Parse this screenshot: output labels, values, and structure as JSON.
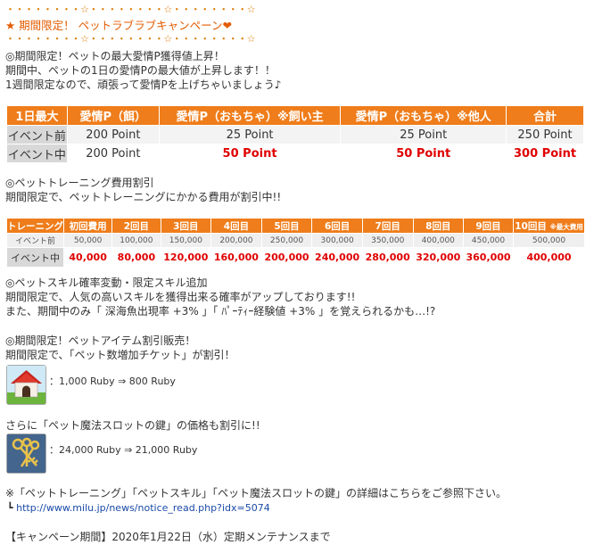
{
  "header": {
    "ornament": "・・・・・・・・☆・・・・・・・・☆・・・・・・・・☆",
    "title": "★ 期間限定！ ペットラブラブキャンペーン❤"
  },
  "section1": {
    "lines": [
      "◎期間限定！ペットの最大愛情P獲得値上昇！",
      "期間中、ペットの1日の愛情Pの最大値が上昇します！！",
      "1週間限定なので、頑張って愛情Pを上げちゃいましょう♪"
    ]
  },
  "table1": {
    "headers": [
      "1日最大",
      "愛情P（餌）",
      "愛情P（おもちゃ）※飼い主",
      "愛情P（おもちゃ）※他人",
      "合計"
    ],
    "rows": [
      {
        "label": "イベント前",
        "values": [
          "200 Point",
          "25 Point",
          "25 Point",
          "250 Point"
        ]
      },
      {
        "label": "イベント中",
        "values": [
          "200 Point",
          "50 Point",
          "50 Point",
          "300 Point"
        ]
      }
    ]
  },
  "section2": {
    "lines": [
      "◎ペットトレーニング費用割引",
      "期間限定で、ペットトレーニングにかかる費用が割引中!!"
    ]
  },
  "table2": {
    "headers": [
      "トレーニング",
      "初回費用",
      "2回目",
      "3回目",
      "4回目",
      "5回目",
      "6回目",
      "7回目",
      "8回目",
      "9回目",
      "10回目"
    ],
    "header_note": "※最大費用",
    "rows": [
      {
        "label": "イベント前",
        "values": [
          "50,000",
          "100,000",
          "150,000",
          "200,000",
          "250,000",
          "300,000",
          "350,000",
          "400,000",
          "450,000",
          "500,000"
        ]
      },
      {
        "label": "イベント中",
        "values": [
          "40,000",
          "80,000",
          "120,000",
          "160,000",
          "200,000",
          "240,000",
          "280,000",
          "320,000",
          "360,000",
          "400,000"
        ]
      }
    ]
  },
  "section3": {
    "lines": [
      "◎ペットスキル確率変動・限定スキル追加",
      "期間限定で、人気の高いスキルを獲得出来る確率がアップしております!!",
      "また、期間中のみ「 深海魚出現率 +3% 」「 ﾊﾟｰﾃｨｰ経験値 +3% 」を覚えられるかも…!?"
    ]
  },
  "section4": {
    "lines": [
      "◎期間限定！ペットアイテム割引販売！",
      "期間限定で、「ペット数増加チケット」が割引！"
    ],
    "item1_price": "：1,000 Ruby ⇒ 800 Ruby",
    "line3": "さらに「ペット魔法スロットの鍵」の価格も割引に!!",
    "item2_price": "：24,000 Ruby ⇒ 21,000 Ruby"
  },
  "footer": {
    "note": "※「ペットトレーニング」「ペットスキル」「ペット魔法スロットの鍵」の詳細はこちらをご参照下さい。",
    "arrow": "┗",
    "link": "http://www.milu.jp/news/notice_read.php?idx=5074",
    "period": "【キャンペーン期間】2020年1月22日（水）定期メンテナンスまで"
  },
  "colors": {
    "header_orange": "#ef7d1b",
    "accent_red": "#e00000",
    "link_blue": "#1a4aa8"
  },
  "icons": [
    "doghouse-icon",
    "keys-icon"
  ]
}
